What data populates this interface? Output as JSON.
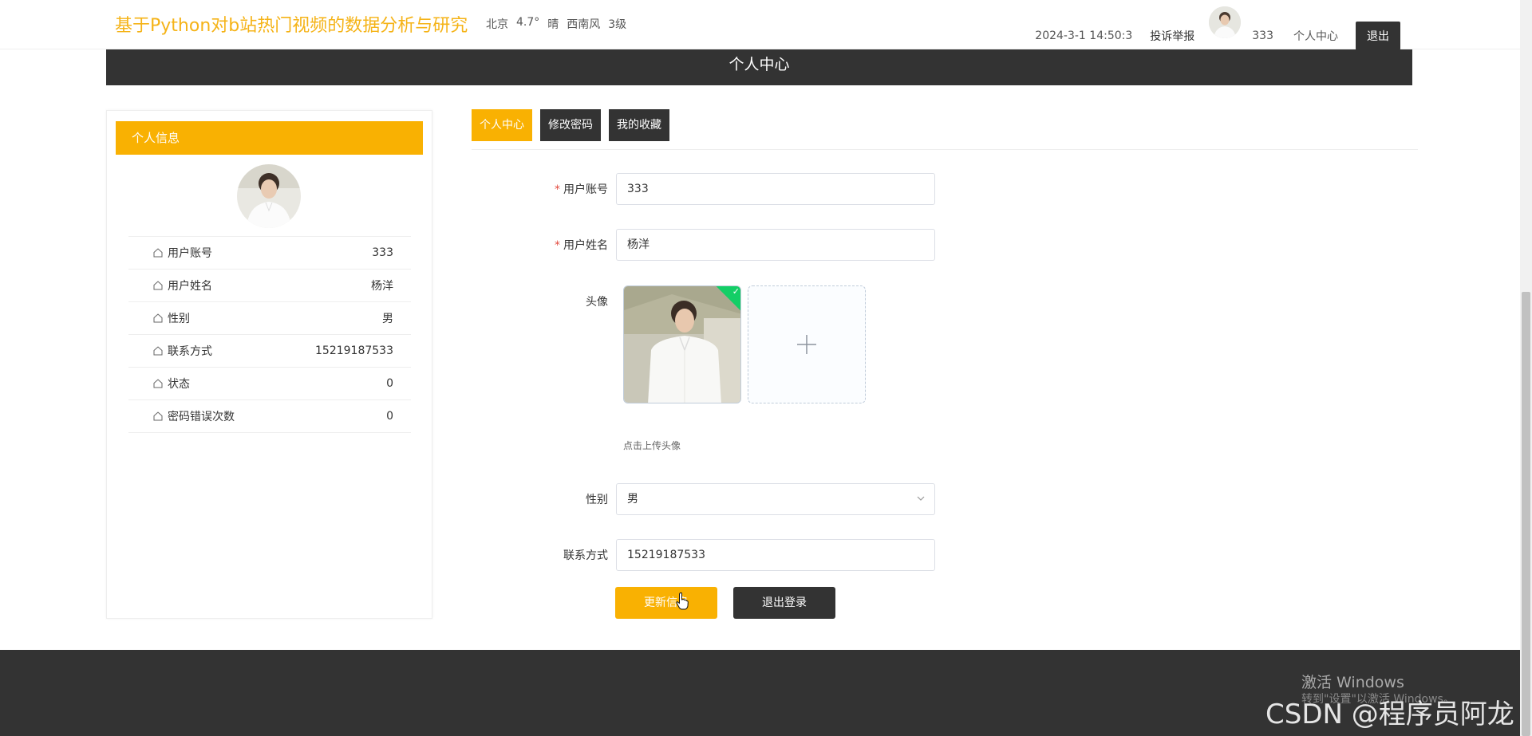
{
  "header": {
    "site_title": "基于Python对b站热门视频的数据分析与研究",
    "weather": {
      "city": "北京",
      "temp": "4.7°",
      "condition": "晴",
      "wind": "西南风",
      "level": "3级"
    },
    "datetime": "2024-3-1 14:50:3",
    "report_link": "投诉举报",
    "username": "333",
    "user_center": "个人中心",
    "logout": "退出"
  },
  "banner": {
    "title": "个人中心"
  },
  "left_panel": {
    "title": "个人信息",
    "rows": [
      {
        "label": "用户账号",
        "value": "333"
      },
      {
        "label": "用户姓名",
        "value": "杨洋"
      },
      {
        "label": "性别",
        "value": "男"
      },
      {
        "label": "联系方式",
        "value": "15219187533"
      },
      {
        "label": "状态",
        "value": "0"
      },
      {
        "label": "密码错误次数",
        "value": "0"
      }
    ]
  },
  "tabs": [
    {
      "label": "个人中心",
      "active": true
    },
    {
      "label": "修改密码",
      "active": false
    },
    {
      "label": "我的收藏",
      "active": false
    }
  ],
  "form": {
    "account": {
      "label": "用户账号",
      "value": "333",
      "required": "*"
    },
    "name": {
      "label": "用户姓名",
      "value": "杨洋",
      "required": "*"
    },
    "avatar": {
      "label": "头像",
      "tip": "点击上传头像"
    },
    "gender": {
      "label": "性别",
      "value": "男"
    },
    "phone": {
      "label": "联系方式",
      "value": "15219187533"
    },
    "update_button": "更新信息",
    "logout_button": "退出登录"
  },
  "footer": {
    "win_activate": "激活 Windows",
    "win_sub": "转到\"设置\"以激活 Windows。",
    "watermark": "CSDN @程序员阿龙"
  },
  "colors": {
    "accent": "#f9b102",
    "dark": "#333333",
    "title": "#f5b317",
    "success": "#13ce66"
  },
  "icons": [
    "house-icon",
    "plus-icon",
    "chevron-down-icon",
    "check-icon",
    "hand-cursor-icon"
  ]
}
